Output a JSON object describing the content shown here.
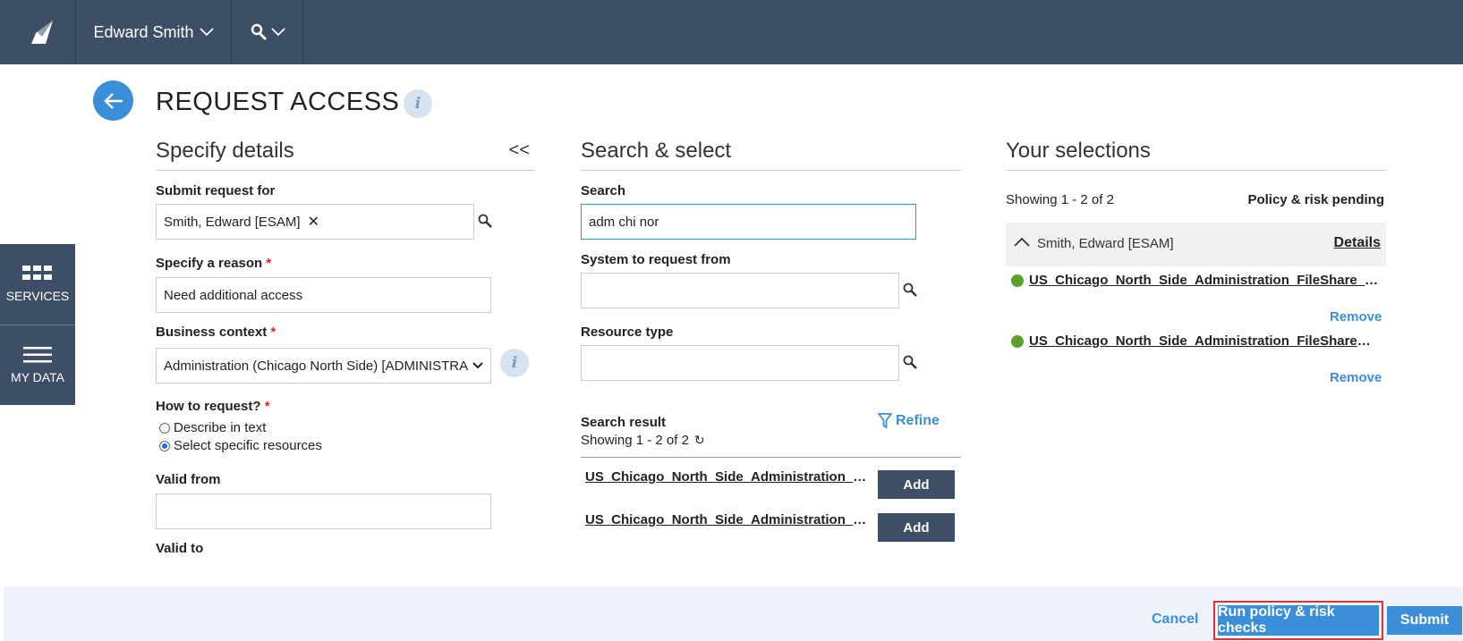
{
  "header": {
    "user_name": "Edward Smith",
    "icons": {
      "logo": "logo-icon",
      "user_dropdown": "chevron-down-icon",
      "search": "search-icon"
    }
  },
  "sidenav": [
    {
      "label": "SERVICES",
      "icon": "grid-icon"
    },
    {
      "label": "MY DATA",
      "icon": "menu-lines-icon"
    }
  ],
  "page": {
    "title": "REQUEST ACCESS"
  },
  "details": {
    "heading": "Specify details",
    "collapse_label": "<<",
    "submit_for_label": "Submit request for",
    "submit_for_value": "Smith, Edward [ESAM]",
    "reason_label": "Specify a reason",
    "reason_value": "Need additional access",
    "business_context_label": "Business context",
    "business_context_value": "Administration (Chicago North Side) [ADMINISTRA",
    "how_label": "How to request?",
    "how_options": [
      {
        "label": "Describe in text",
        "selected": false
      },
      {
        "label": "Select specific resources",
        "selected": true
      }
    ],
    "valid_from_label": "Valid from",
    "valid_to_label": "Valid to",
    "required_mark": "*"
  },
  "search": {
    "heading": "Search & select",
    "search_label": "Search",
    "search_value": "adm chi nor",
    "system_label": "System to request from",
    "resource_type_label": "Resource type",
    "result_label": "Search result",
    "showing": "Showing 1 - 2 of 2",
    "refine_label": "Refine",
    "results": [
      {
        "name": "US_Chicago_North_Side_Administration_FileShare_Read",
        "action": "Add"
      },
      {
        "name": "US_Chicago_North_Side_Administration_FileShare_Write",
        "action": "Add"
      }
    ]
  },
  "selections": {
    "heading": "Your selections",
    "showing": "Showing 1 - 2 of 2",
    "status": "Policy & risk pending",
    "group_name": "Smith, Edward [ESAM]",
    "details_link": "Details",
    "items": [
      {
        "name": "US_Chicago_North_Side_Administration_FileShare_Read",
        "action": "Remove",
        "status_color": "#5aa02c"
      },
      {
        "name": "US_Chicago_North_Side_Administration_FileShare_Write",
        "action": "Remove",
        "status_color": "#5aa02c"
      }
    ]
  },
  "footer": {
    "cancel": "Cancel",
    "run_checks": "Run policy & risk checks",
    "submit": "Submit"
  },
  "colors": {
    "nav": "#3c4f66",
    "accent": "#3b8fd9",
    "ok": "#5aa02c",
    "highlight": "#d33"
  }
}
